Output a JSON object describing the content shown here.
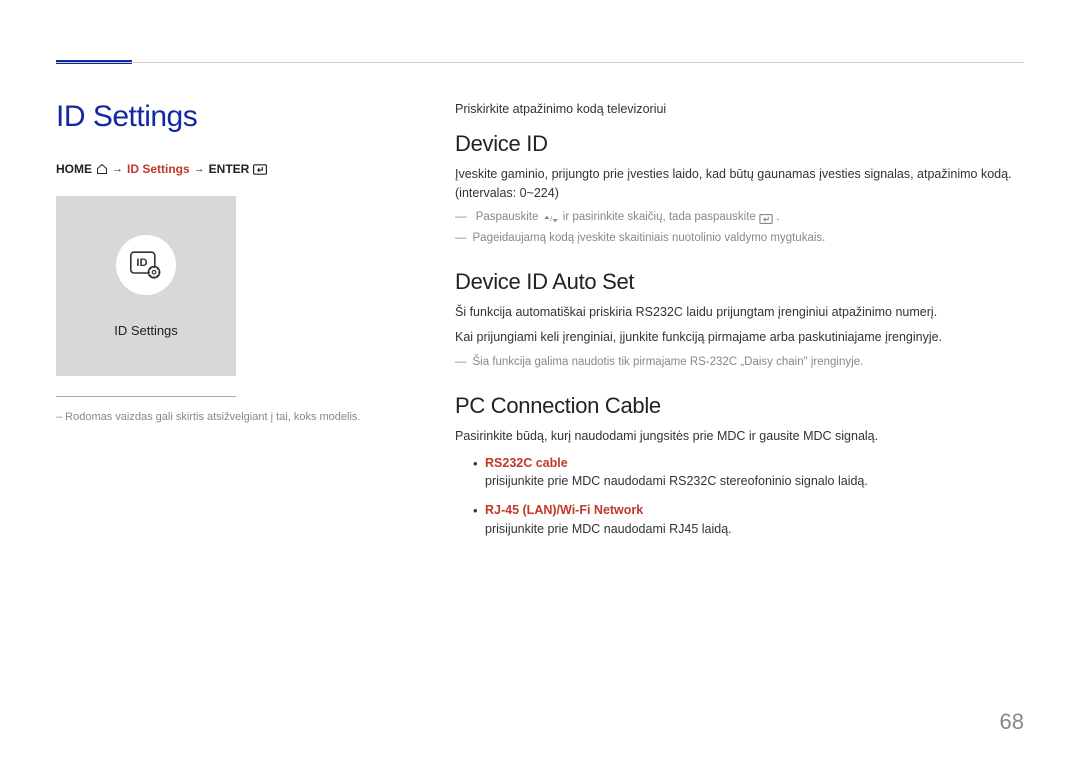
{
  "header": {
    "page_title": "ID Settings"
  },
  "breadcrumb": {
    "home": "HOME",
    "id_settings": "ID Settings",
    "enter": "ENTER"
  },
  "preview": {
    "label": "ID Settings"
  },
  "left_footnote": "–   Rodomas vaizdas gali skirtis atsižvelgiant į tai, koks modelis.",
  "sections": {
    "intro": "Priskirkite atpažinimo kodą televizoriui",
    "device_id": {
      "heading": "Device ID",
      "p1": "Įveskite gaminio, prijungto prie įvesties laido, kad būtų gaunamas įvesties signalas, atpažinimo kodą. (intervalas: 0~224)",
      "note1_a": "Paspauskite ",
      "note1_b": " ir pasirinkite skaičių, tada paspauskite ",
      "note1_c": ".",
      "note2": "Pageidaujamą kodą įveskite skaitiniais nuotolinio valdymo mygtukais."
    },
    "auto_set": {
      "heading": "Device ID Auto Set",
      "p1": "Ši funkcija automatiškai priskiria RS232C laidu prijungtam įrenginiui atpažinimo numerį.",
      "p2": "Kai prijungiami keli įrenginiai, įjunkite funkciją pirmajame arba paskutiniajame įrenginyje.",
      "note1": "Šia funkcija galima naudotis tik pirmajame RS-232C „Daisy chain\" įrenginyje."
    },
    "pc_cable": {
      "heading": "PC Connection Cable",
      "p1": "Pasirinkite būdą, kurį naudodami jungsitės prie MDC ir gausite MDC signalą.",
      "bullets": [
        {
          "title": "RS232C cable",
          "desc": "prisijunkite prie MDC naudodami RS232C stereofoninio signalo laidą."
        },
        {
          "title": "RJ-45 (LAN)/Wi-Fi Network",
          "desc": "prisijunkite prie MDC naudodami RJ45 laidą."
        }
      ]
    }
  },
  "page_number": "68"
}
